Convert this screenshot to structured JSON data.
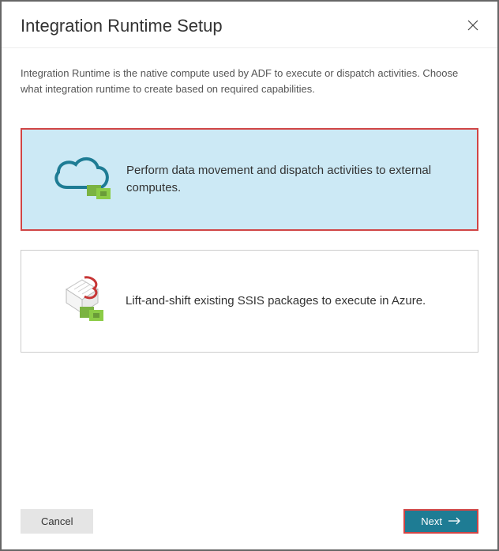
{
  "header": {
    "title": "Integration Runtime Setup"
  },
  "description": "Integration Runtime is the native compute used by ADF to execute or dispatch activities. Choose what integration runtime to create based on required capabilities.",
  "options": {
    "item0": {
      "text": "Perform data movement and dispatch activities to external computes.",
      "selected": true
    },
    "item1": {
      "text": "Lift-and-shift existing SSIS packages to execute in Azure.",
      "selected": false
    }
  },
  "footer": {
    "cancel_label": "Cancel",
    "next_label": "Next"
  }
}
